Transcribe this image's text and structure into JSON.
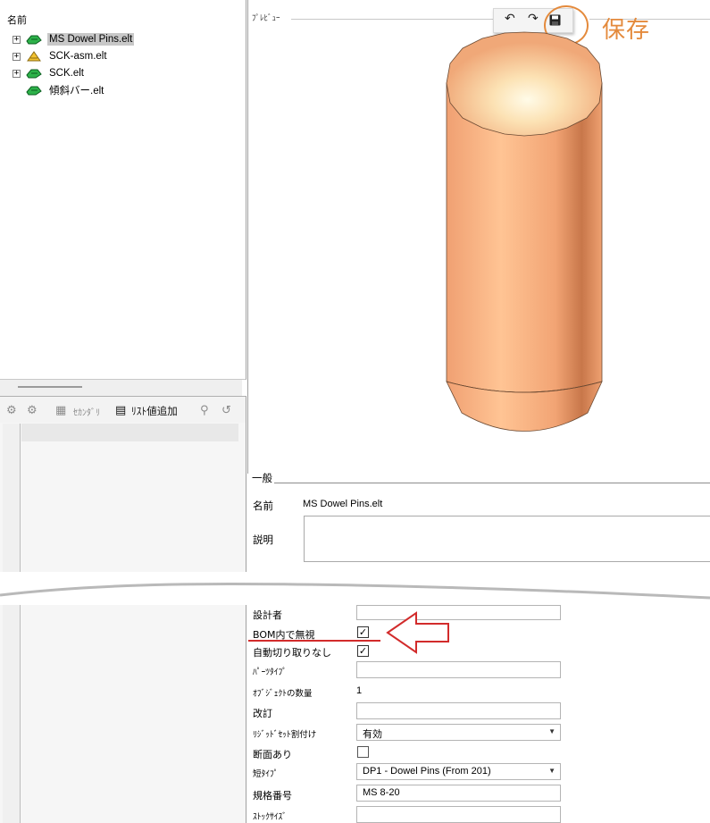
{
  "tree": {
    "header": "名前",
    "items": [
      {
        "label": "MS Dowel Pins.elt",
        "expander": "+",
        "icon": "part-icon",
        "selected": true
      },
      {
        "label": "SCK-asm.elt",
        "expander": "+",
        "icon": "assembly-icon",
        "selected": false
      },
      {
        "label": "SCK.elt",
        "expander": "+",
        "icon": "part-icon",
        "selected": false
      },
      {
        "label": "傾斜バー.elt",
        "expander": "",
        "icon": "part-icon",
        "selected": false
      }
    ]
  },
  "left_toolbar": {
    "secondary_label": "ｾｶﾝﾀﾞﾘ",
    "add_list_value_label": "ﾘｽﾄ値追加"
  },
  "preview": {
    "label": "ﾌﾟﾚﾋﾞｭｰ",
    "toolbar": {
      "undo": "↶",
      "redo": "↷",
      "save": "💾"
    },
    "save_annotation": "保存",
    "model_color": "#f2a877"
  },
  "general": {
    "title": "一般",
    "name_label": "名前",
    "name_value": "MS Dowel Pins.elt",
    "description_label": "説明",
    "description_value": ""
  },
  "properties": {
    "designer_label": "設計者",
    "designer_value": "",
    "ignore_in_bom_label": "BOM内で無視",
    "ignore_in_bom_checked": "✓",
    "no_auto_cut_label": "自動切り取りなし",
    "no_auto_cut_checked": "✓",
    "part_type_label": "ﾊﾟｰﾂﾀｲﾌﾟ",
    "part_type_value": "",
    "object_count_label": "ｵﾌﾞｼﾞｪｸﾄの数量",
    "object_count_value": "1",
    "revision_label": "改訂",
    "revision_value": "",
    "rigid_set_label": "ﾘｼﾞｯﾄﾞｾｯﾄ割付け",
    "rigid_set_value": "有効",
    "has_section_label": "断面あり",
    "has_section_checked": "",
    "short_type_label": "短ﾀｲﾌﾟ",
    "short_type_value": "DP1 - Dowel Pins (From 201)",
    "standard_number_label": "規格番号",
    "standard_number_value": "MS 8-20",
    "stock_size_label": "ｽﾄｯｸｻｲｽﾞ",
    "stock_size_value": ""
  },
  "colors": {
    "annotation_orange": "#e48a3c",
    "annotation_red": "#d22b2b"
  }
}
